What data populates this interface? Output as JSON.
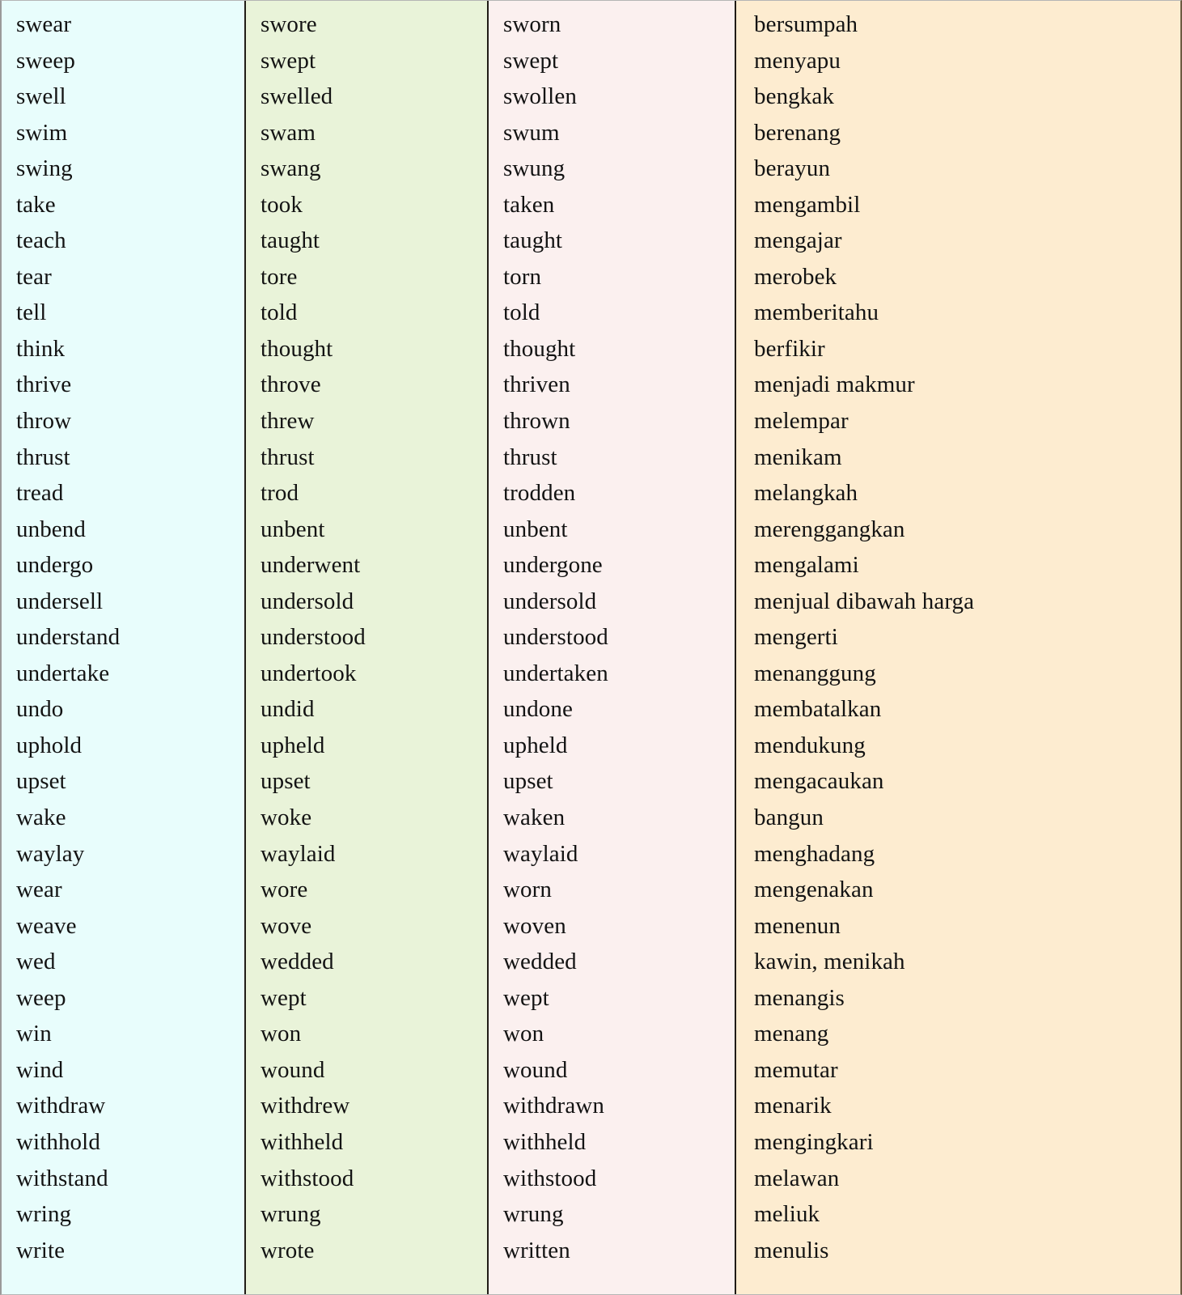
{
  "table": {
    "columns": [
      {
        "id": "base",
        "name": "base-form-column",
        "bg": "#e8fdfc"
      },
      {
        "id": "past",
        "name": "past-simple-column",
        "bg": "#e9f3d9"
      },
      {
        "id": "participle",
        "name": "past-participle-column",
        "bg": "#fbf0ef"
      },
      {
        "id": "meaning",
        "name": "indonesian-meaning-column",
        "bg": "#fdecd0"
      }
    ],
    "border_color": "#201c16",
    "row_count": 35,
    "rows": [
      {
        "base": "swear",
        "past": "swore",
        "participle": "sworn",
        "meaning": "bersumpah"
      },
      {
        "base": "sweep",
        "past": "swept",
        "participle": "swept",
        "meaning": "menyapu"
      },
      {
        "base": "swell",
        "past": "swelled",
        "participle": "swollen",
        "meaning": "bengkak"
      },
      {
        "base": "swim",
        "past": "swam",
        "participle": "swum",
        "meaning": "berenang"
      },
      {
        "base": "swing",
        "past": "swang",
        "participle": "swung",
        "meaning": "berayun"
      },
      {
        "base": "take",
        "past": "took",
        "participle": "taken",
        "meaning": "mengambil"
      },
      {
        "base": "teach",
        "past": "taught",
        "participle": "taught",
        "meaning": "mengajar"
      },
      {
        "base": "tear",
        "past": "tore",
        "participle": "torn",
        "meaning": "merobek"
      },
      {
        "base": "tell",
        "past": "told",
        "participle": "told",
        "meaning": "memberitahu"
      },
      {
        "base": "think",
        "past": "thought",
        "participle": "thought",
        "meaning": "berfikir"
      },
      {
        "base": "thrive",
        "past": "throve",
        "participle": "thriven",
        "meaning": "menjadi makmur"
      },
      {
        "base": "throw",
        "past": "threw",
        "participle": "thrown",
        "meaning": "melempar"
      },
      {
        "base": "thrust",
        "past": "thrust",
        "participle": "thrust",
        "meaning": "menikam"
      },
      {
        "base": "tread",
        "past": "trod",
        "participle": "trodden",
        "meaning": "melangkah"
      },
      {
        "base": "unbend",
        "past": "unbent",
        "participle": "unbent",
        "meaning": "merenggangkan"
      },
      {
        "base": "undergo",
        "past": "underwent",
        "participle": "undergone",
        "meaning": "mengalami"
      },
      {
        "base": "undersell",
        "past": "undersold",
        "participle": "undersold",
        "meaning": "menjual dibawah harga"
      },
      {
        "base": "understand",
        "past": "understood",
        "participle": "understood",
        "meaning": "mengerti"
      },
      {
        "base": "undertake",
        "past": "undertook",
        "participle": "undertaken",
        "meaning": "menanggung"
      },
      {
        "base": "undo",
        "past": "undid",
        "participle": "undone",
        "meaning": "membatalkan"
      },
      {
        "base": "uphold",
        "past": "upheld",
        "participle": "upheld",
        "meaning": "mendukung"
      },
      {
        "base": "upset",
        "past": "upset",
        "participle": "upset",
        "meaning": "mengacaukan"
      },
      {
        "base": "wake",
        "past": "woke",
        "participle": "waken",
        "meaning": "bangun"
      },
      {
        "base": "waylay",
        "past": "waylaid",
        "participle": "waylaid",
        "meaning": "menghadang"
      },
      {
        "base": "wear",
        "past": "wore",
        "participle": "worn",
        "meaning": "mengenakan"
      },
      {
        "base": "weave",
        "past": "wove",
        "participle": "woven",
        "meaning": "menenun"
      },
      {
        "base": "wed",
        "past": "wedded",
        "participle": "wedded",
        "meaning": "kawin, menikah"
      },
      {
        "base": "weep",
        "past": "wept",
        "participle": "wept",
        "meaning": "menangis"
      },
      {
        "base": "win",
        "past": "won",
        "participle": "won",
        "meaning": "menang"
      },
      {
        "base": "wind",
        "past": "wound",
        "participle": "wound",
        "meaning": "memutar"
      },
      {
        "base": "withdraw",
        "past": "withdrew",
        "participle": "withdrawn",
        "meaning": "menarik"
      },
      {
        "base": "withhold",
        "past": "withheld",
        "participle": "withheld",
        "meaning": "mengingkari"
      },
      {
        "base": "withstand",
        "past": "withstood",
        "participle": "withstood",
        "meaning": "melawan"
      },
      {
        "base": "wring",
        "past": "wrung",
        "participle": "wrung",
        "meaning": "meliuk"
      },
      {
        "base": "write",
        "past": "wrote",
        "participle": "written",
        "meaning": "menulis"
      }
    ]
  }
}
